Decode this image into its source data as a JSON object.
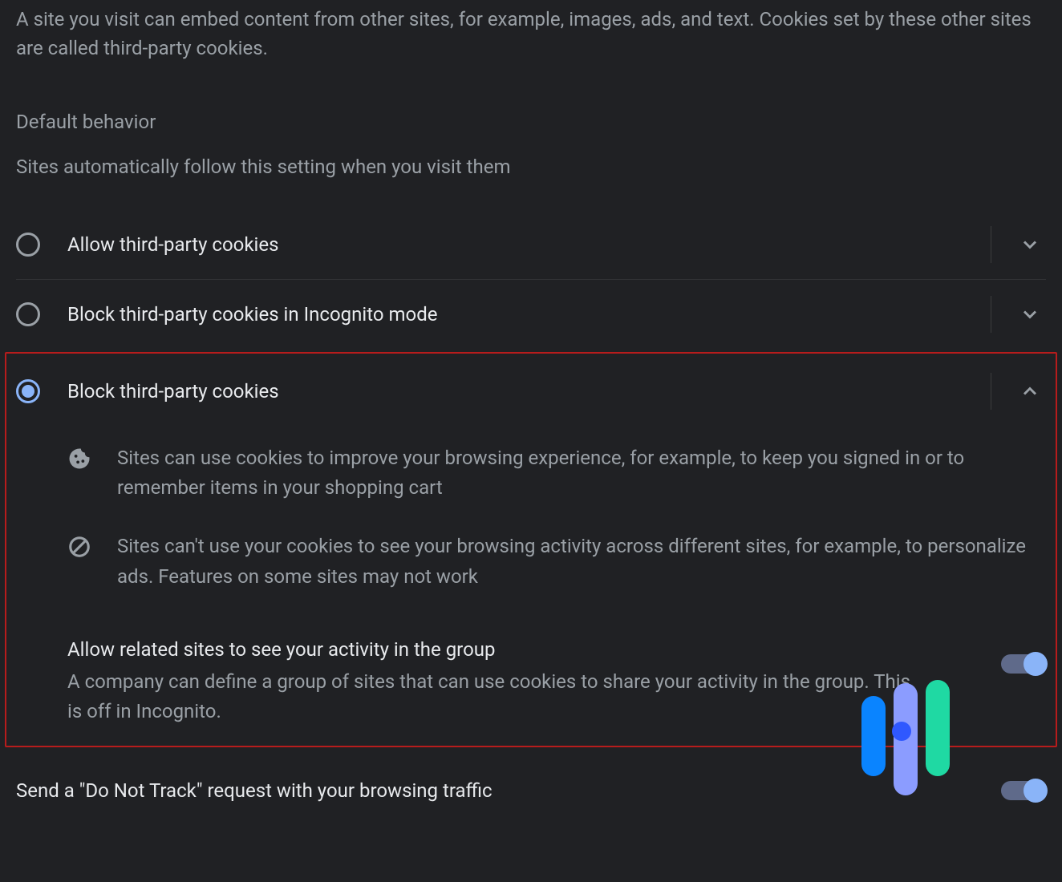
{
  "intro": "A site you visit can embed content from other sites, for example, images, ads, and text. Cookies set by these other sites are called third-party cookies.",
  "section_header": "Default behavior",
  "section_sub": "Sites automatically follow this setting when you visit them",
  "options": {
    "allow": {
      "label": "Allow third-party cookies",
      "selected": false,
      "expanded": false
    },
    "block_incognito": {
      "label": "Block third-party cookies in Incognito mode",
      "selected": false,
      "expanded": false
    },
    "block": {
      "label": "Block third-party cookies",
      "selected": true,
      "expanded": true
    }
  },
  "block_details": {
    "cookie_text": "Sites can use cookies to improve your browsing experience, for example, to keep you signed in or to remember items in your shopping cart",
    "block_text": "Sites can't use your cookies to see your browsing activity across different sites, for example, to personalize ads. Features on some sites may not work"
  },
  "related_sites": {
    "title": "Allow related sites to see your activity in the group",
    "desc": "A company can define a group of sites that can use cookies to share your activity in the group. This is off in Incognito.",
    "enabled": true
  },
  "dnt": {
    "label": "Send a \"Do Not Track\" request with your browsing traffic",
    "enabled": true
  },
  "colors": {
    "accent": "#8ab4f8",
    "highlight_border": "#b71c1c"
  }
}
